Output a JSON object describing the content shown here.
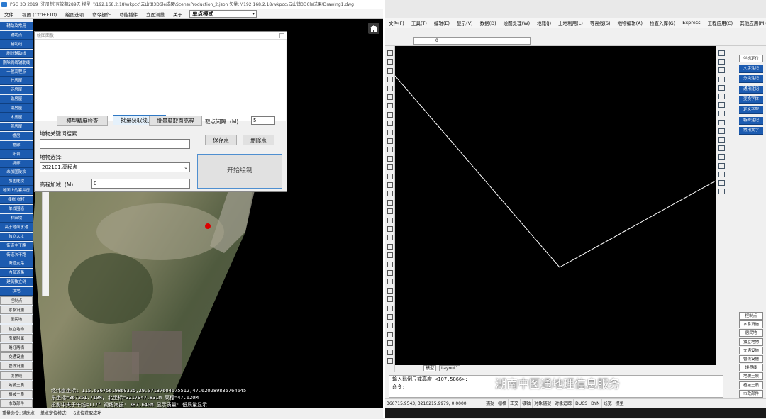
{
  "left_app": {
    "title": "PSG 3D 2019 (注册制)有效期289天 模型: \\\\192.168.2.18\\wkpcc\\云山镇3D6le成果\\Scene\\Production_2.json 矢量: \\\\192.168.2.18\\wkpcc\\云山镇3D6le成果\\Drawing1.dwg",
    "menu": [
      "文件",
      "视图 (Ctrl+F10)",
      "绘图选项",
      "命令操作",
      "功能插件",
      "立面测量",
      "关于"
    ],
    "mode": "单点模式",
    "left_panel": [
      "辅助及常用",
      "辅助点",
      "辅助线",
      "刷线辅助线",
      "删除刷线辅助线",
      "一般高程点",
      "砼房屋",
      "砖房屋",
      "铁房屋",
      "钢房屋",
      "木房屋",
      "混房屋",
      "檐房",
      "檐廊",
      "阳台",
      "挑廊",
      "未加固陡坎",
      "加固陡坎",
      "地面上的窨井房",
      "栅栏 栏杆",
      "单线围墙",
      "林田坎",
      "高于地面水池",
      "独立大坟",
      "街道主干路",
      "街道次干路",
      "街道支路",
      "内部道路",
      "建筑独立树",
      "坟地"
    ],
    "left_panel_bottom": [
      "控制点",
      "水系设施",
      "居民地",
      "独立地物",
      "房屋附属",
      "路灯两栖",
      "交通设施",
      "管线设施",
      "境界线",
      "地貌土质",
      "植被土质",
      "市政部件"
    ],
    "dialog": {
      "caption": "绘图面板",
      "btn_check": "模型精度检查",
      "btn_batch_line": "批量获取线上高",
      "btn_batch_face": "批量获取面高程",
      "interval_label": "取点间隔: (M)",
      "interval_value": "5",
      "keyword_label": "地物关键词搜索:",
      "keyword_value": "",
      "save_btn": "保存点",
      "delete_btn": "删除点",
      "feature_label": "地物选择:",
      "feature_value": "202101,高程点",
      "height_label": "高程加减: (M)",
      "height_value": "0",
      "start_btn": "开始绘制"
    },
    "coords": [
      "经纬度坐标: 115.63675619869325,29.07137604675512,47.620289835764645",
      "东坐标=367251.710M, 北坐标=3217947.831M  高程=47.620M",
      "投影中央子午线=117°    视线海拔: 387.640M  显示质量: 低质量显示"
    ],
    "status": [
      "重量命令: 辅助点",
      "单点定位模式!",
      "6点位获取成功"
    ]
  },
  "right_app": {
    "menu": [
      "文件(F)",
      "工具(T)",
      "编辑(E)",
      "显示(V)",
      "数据(D)",
      "绘图处理(W)",
      "地籍(J)",
      "土地利用(L)",
      "等高线(S)",
      "地物编辑(A)",
      "检查入库(G)",
      "Express",
      "工程应用(C)",
      "其他应用(M)"
    ],
    "layer_value": "0",
    "right_panel_top": [
      "坐标定位",
      "文字注记",
      "分类注记",
      "通用注记",
      "变换字体",
      "定义字型",
      "特殊注记",
      "常用文字"
    ],
    "right_panel_bottom": [
      "控制点",
      "水系设施",
      "居民地",
      "独立地物",
      "交通设施",
      "管线设施",
      "境界线",
      "地貌土质",
      "植被土质",
      "市政部件"
    ],
    "tabs": [
      "模型",
      "Layout1"
    ],
    "cmd_line1": "输入比例尺或高度 <107.5866>:",
    "cmd_line2": "命令:",
    "status_coords": "366715.9543, 3210215.9979, 0.0000",
    "status_modes": [
      "捕捉",
      "栅格",
      "正交",
      "极轴",
      "对象捕捉",
      "对象追踪",
      "DUCS",
      "DYN",
      "线宽",
      "模型"
    ],
    "watermark": "湖南中图通地理信息服务"
  },
  "colors": {
    "accent": "#1c5bb0",
    "canvas": "#000000",
    "line": "#ffffff"
  }
}
